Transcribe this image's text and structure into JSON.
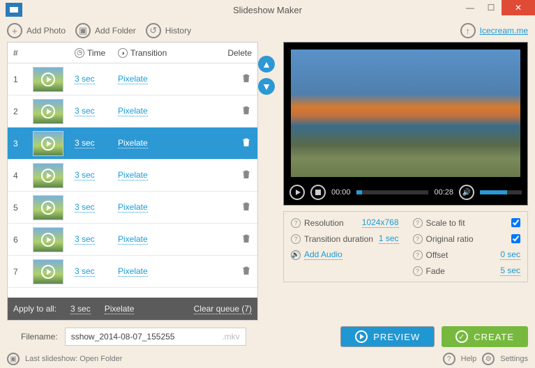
{
  "app": {
    "title": "Slideshow Maker"
  },
  "toolbar": {
    "add_photo": "Add Photo",
    "add_folder": "Add Folder",
    "history": "History",
    "brand": "Icecream.me"
  },
  "table": {
    "headers": {
      "num": "#",
      "time": "Time",
      "transition": "Transition",
      "delete": "Delete"
    },
    "rows": [
      {
        "n": "1",
        "time": "3 sec",
        "transition": "Pixelate",
        "selected": false
      },
      {
        "n": "2",
        "time": "3 sec",
        "transition": "Pixelate",
        "selected": false
      },
      {
        "n": "3",
        "time": "3 sec",
        "transition": "Pixelate",
        "selected": true
      },
      {
        "n": "4",
        "time": "3 sec",
        "transition": "Pixelate",
        "selected": false
      },
      {
        "n": "5",
        "time": "3 sec",
        "transition": "Pixelate",
        "selected": false
      },
      {
        "n": "6",
        "time": "3 sec",
        "transition": "Pixelate",
        "selected": false
      },
      {
        "n": "7",
        "time": "3 sec",
        "transition": "Pixelate",
        "selected": false
      }
    ],
    "apply_row": {
      "label": "Apply to all:",
      "time": "3 sec",
      "transition": "Pixelate",
      "clear": "Clear queue (7)"
    }
  },
  "player": {
    "current": "00:00",
    "total": "00:28"
  },
  "settings": {
    "resolution_label": "Resolution",
    "resolution_value": "1024x768",
    "transition_label": "Transition duration",
    "transition_value": "1 sec",
    "add_audio": "Add Audio",
    "scale_label": "Scale to fit",
    "scale_checked": true,
    "ratio_label": "Original ratio",
    "ratio_checked": true,
    "offset_label": "Offset",
    "offset_value": "0 sec",
    "fade_label": "Fade",
    "fade_value": "5 sec"
  },
  "filename": {
    "label": "Filename:",
    "value": "sshow_2014-08-07_155255",
    "ext": ".mkv"
  },
  "buttons": {
    "preview": "PREVIEW",
    "create": "CREATE"
  },
  "footer": {
    "last": "Last slideshow: Open Folder",
    "help": "Help",
    "settings": "Settings"
  }
}
